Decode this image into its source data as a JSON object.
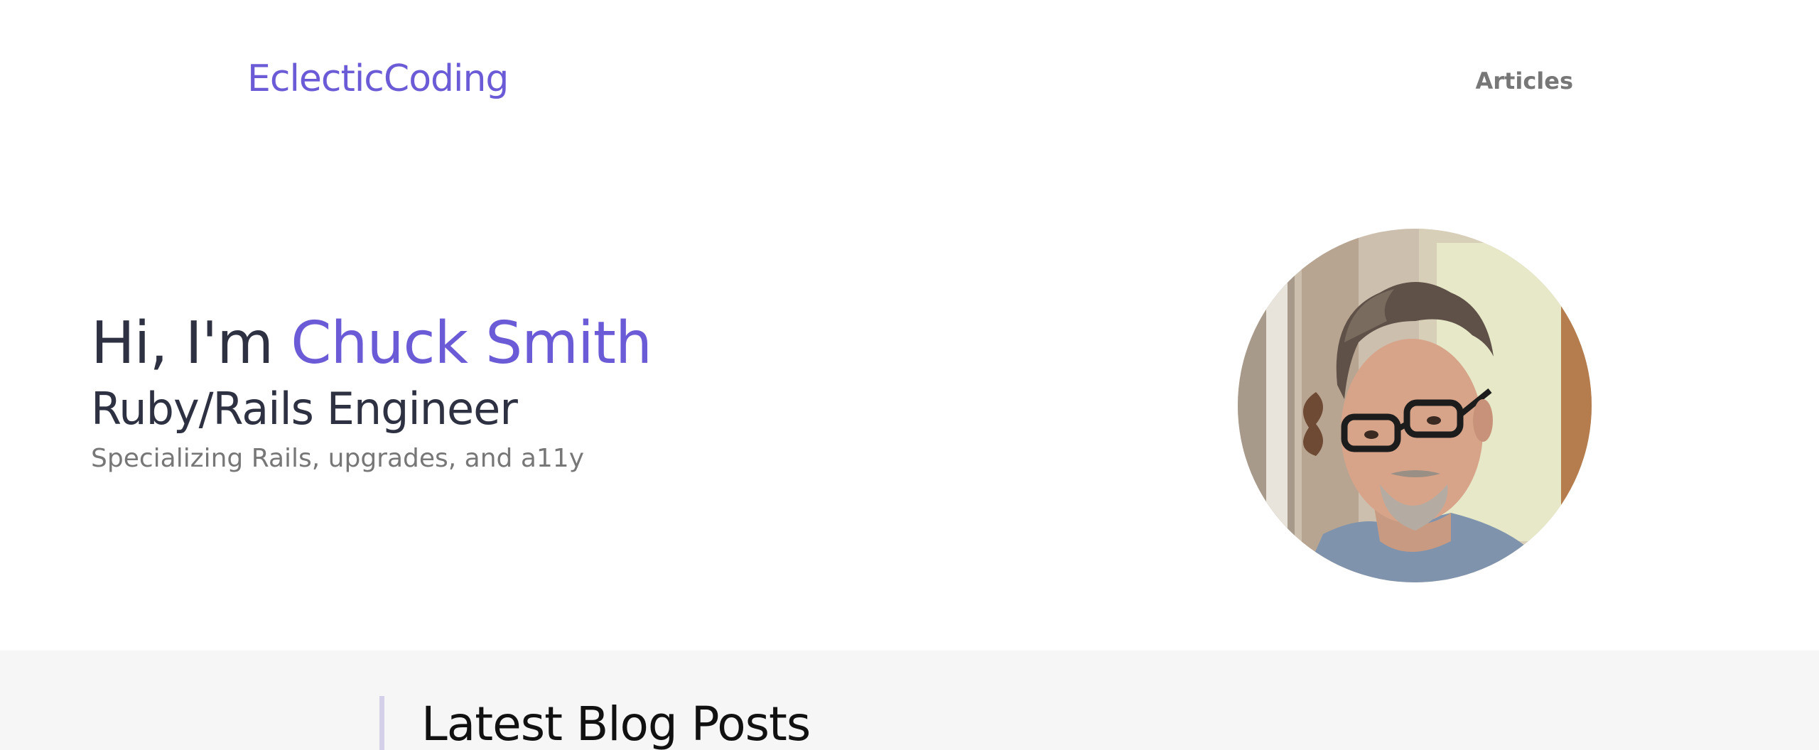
{
  "colors": {
    "accent": "#6b5bd6",
    "heading": "#2d3142",
    "muted": "#777777",
    "section_bg": "#f6f6f6",
    "page_bg": "#ffffff",
    "blog_heading": "#111111"
  },
  "header": {
    "logo": "EclecticCoding",
    "nav": [
      {
        "label": "Articles"
      }
    ]
  },
  "hero": {
    "greeting_prefix": "Hi, I'm ",
    "name": "Chuck Smith",
    "role": "Ruby/Rails Engineer",
    "tagline": "Specializing Rails, upgrades, and a11y",
    "avatar_icon": "profile-photo"
  },
  "blog": {
    "heading": "Latest Blog Posts"
  }
}
